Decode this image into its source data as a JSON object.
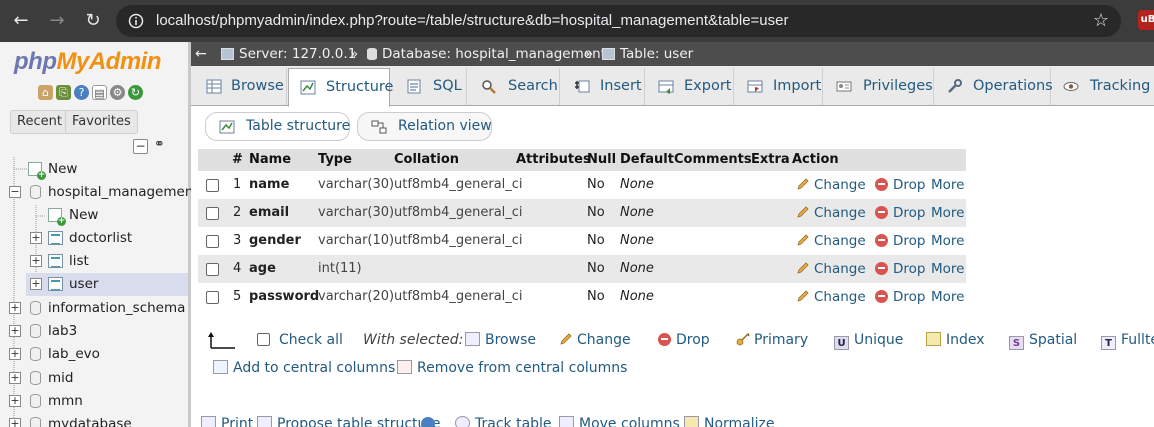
{
  "browser": {
    "url": "localhost/phpmyadmin/index.php?route=/table/structure&db=hospital_management&table=user",
    "back_icon": "arrow-left-icon",
    "forward_icon": "arrow-right-icon",
    "reload_icon": "reload-icon",
    "star_icon": "star-icon",
    "extension_label": "uB"
  },
  "sidebar": {
    "logo_php": "php",
    "logo_myadmin": "MyAdmin",
    "recent_label": "Recent",
    "favorites_label": "Favorites",
    "tree": {
      "new_root": "New",
      "db_hospital": "hospital_management",
      "new_child": "New",
      "doctorlist": "doctorlist",
      "list": "list",
      "user": "user",
      "information_schema": "information_schema",
      "lab3": "lab3",
      "lab_evo": "lab_evo",
      "mid": "mid",
      "mmn": "mmn",
      "mydatabase": "mydatabase"
    }
  },
  "breadcrumb": {
    "server": "Server: 127.0.0.1",
    "database": "Database: hospital_management",
    "table": "Table: user",
    "sep": "»"
  },
  "tabs": {
    "browse": "Browse",
    "structure": "Structure",
    "sql": "SQL",
    "search": "Search",
    "insert": "Insert",
    "export": "Export",
    "import": "Import",
    "privileges": "Privileges",
    "operations": "Operations",
    "tracking": "Tracking"
  },
  "subtabs": {
    "table_structure": "Table structure",
    "relation_view": "Relation view"
  },
  "table": {
    "headers": {
      "num": "#",
      "name": "Name",
      "type": "Type",
      "collation": "Collation",
      "attributes": "Attributes",
      "null": "Null",
      "default": "Default",
      "comments": "Comments",
      "extra": "Extra",
      "action": "Action"
    },
    "rows": [
      {
        "num": "1",
        "name": "name",
        "type": "varchar(30)",
        "collation": "utf8mb4_general_ci",
        "null": "No",
        "default": "None"
      },
      {
        "num": "2",
        "name": "email",
        "type": "varchar(30)",
        "collation": "utf8mb4_general_ci",
        "null": "No",
        "default": "None"
      },
      {
        "num": "3",
        "name": "gender",
        "type": "varchar(10)",
        "collation": "utf8mb4_general_ci",
        "null": "No",
        "default": "None"
      },
      {
        "num": "4",
        "name": "age",
        "type": "int(11)",
        "collation": "",
        "null": "No",
        "default": "None"
      },
      {
        "num": "5",
        "name": "password",
        "type": "varchar(20)",
        "collation": "utf8mb4_general_ci",
        "null": "No",
        "default": "None"
      }
    ],
    "action_change": "Change",
    "action_drop": "Drop",
    "action_more": "More"
  },
  "with_selected": {
    "check_all": "Check all",
    "label": "With selected:",
    "browse": "Browse",
    "change": "Change",
    "drop": "Drop",
    "primary": "Primary",
    "unique": "Unique",
    "index": "Index",
    "spatial": "Spatial",
    "fulltext": "Fulltex"
  },
  "central": {
    "add": "Add to central columns",
    "remove": "Remove from central columns"
  },
  "bottom": {
    "print": "Print",
    "propose": "Propose table structure",
    "track": "Track table",
    "move": "Move columns",
    "normalize": "Normalize"
  }
}
